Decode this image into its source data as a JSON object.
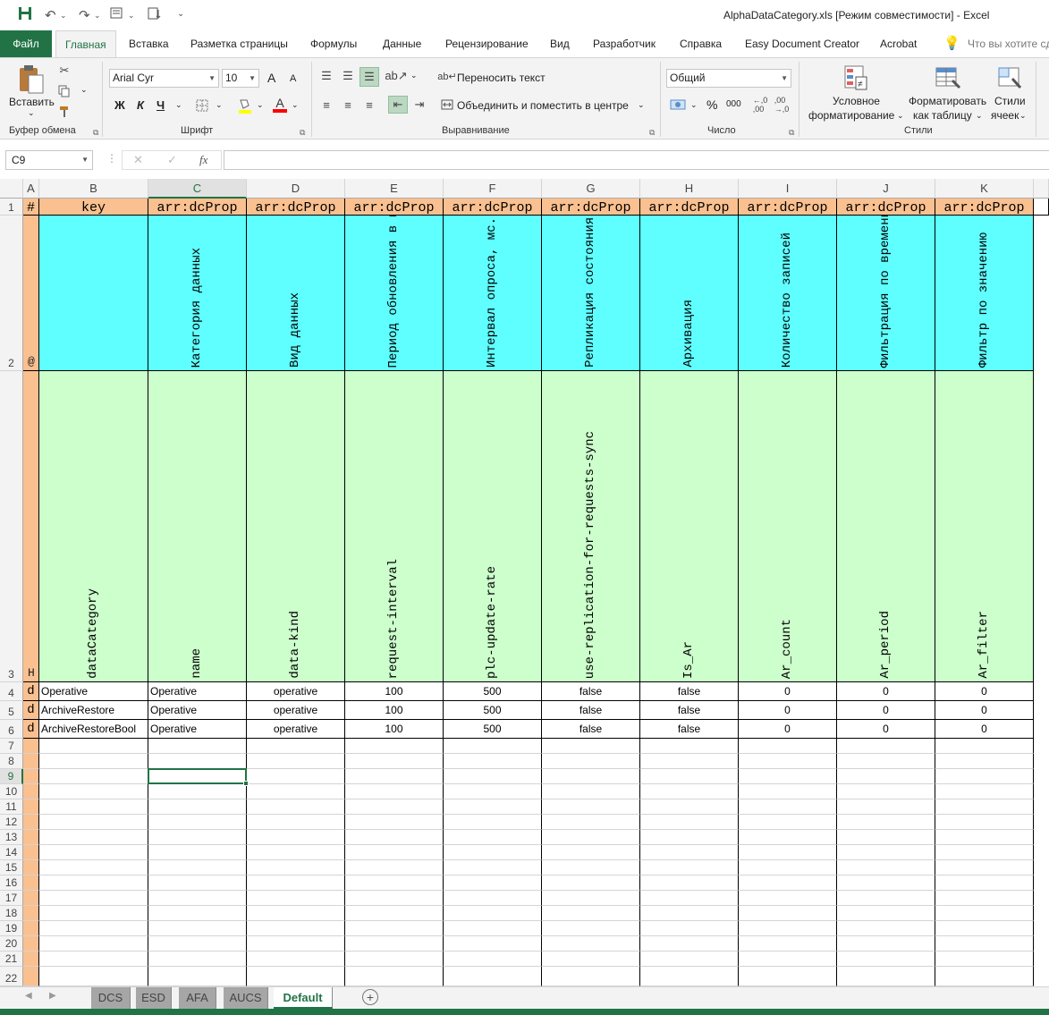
{
  "app": {
    "document_title": "AlphaDataCategory.xls  [Режим совместимости]  -  Excel"
  },
  "quick_access": {
    "save_icon": "save-icon",
    "undo_icon": "undo-icon",
    "redo_icon": "redo-icon",
    "customize_icon": "chevron-down-icon"
  },
  "menu": {
    "file": "Файл",
    "tabs": [
      "Главная",
      "Вставка",
      "Разметка страницы",
      "Формулы",
      "Данные",
      "Рецензирование",
      "Вид",
      "Разработчик",
      "Справка",
      "Easy Document Creator",
      "Acrobat"
    ],
    "active_tab": "Главная",
    "search_placeholder": "Что вы хотите сд"
  },
  "ribbon": {
    "clipboard": {
      "paste_label": "Вставить",
      "group_label": "Буфер обмена"
    },
    "font": {
      "font_name": "Arial Cyr",
      "font_size": "10",
      "bold": "Ж",
      "italic": "К",
      "underline": "Ч",
      "grow": "A",
      "shrink": "A",
      "font_color_letter": "A",
      "highlight_color": "#ffff00",
      "font_color": "#ff0000",
      "group_label": "Шрифт"
    },
    "alignment": {
      "wrap_text": "Переносить текст",
      "merge_center": "Объединить и поместить в центре",
      "group_label": "Выравнивание"
    },
    "number": {
      "format": "Общий",
      "percent": "%",
      "thousands": "000",
      "group_label": "Число"
    },
    "styles": {
      "conditional_line1": "Условное",
      "conditional_line2": "форматирование",
      "table_line1": "Форматировать",
      "table_line2": "как таблицу",
      "cell_styles_line1": "Стили",
      "cell_styles_line2": "ячеек",
      "group_label": "Стили"
    }
  },
  "formula_bar": {
    "name_box": "C9",
    "fx": "fx",
    "cancel": "✕",
    "enter": "✓",
    "value": ""
  },
  "grid": {
    "columns": [
      "A",
      "B",
      "C",
      "D",
      "E",
      "F",
      "G",
      "H",
      "I",
      "J",
      "K"
    ],
    "selected_column": "C",
    "selected_row": "9",
    "row_numbers": [
      "1",
      "2",
      "3",
      "4",
      "5",
      "6",
      "7",
      "8",
      "9",
      "10",
      "11",
      "12",
      "13",
      "14",
      "15",
      "16",
      "17",
      "18",
      "19",
      "20",
      "21",
      "22"
    ],
    "row1": [
      "#",
      "key",
      "arr:dcProp",
      "arr:dcProp",
      "arr:dcProp",
      "arr:dcProp",
      "arr:dcProp",
      "arr:dcProp",
      "arr:dcProp",
      "arr:dcProp",
      "arr:dcProp"
    ],
    "row2": [
      "@",
      "",
      "Категория данных",
      "Вид данных",
      "Период обновления в контроллере, мс.",
      "Интервал опроса, мс.",
      "Репликация состояния чтения",
      "Архивация",
      "Количество записей",
      "Фильтрация по времени",
      "Фильтр по значению"
    ],
    "row3": [
      "H",
      "dataCategory",
      "name",
      "data-kind",
      "request-interval",
      "plc-update-rate",
      "use-replication-for-requests-sync",
      "Is_Ar",
      "Ar_count",
      "Ar_period",
      "Ar_filter"
    ],
    "data_rows": [
      [
        "d",
        "Operative",
        "Operative",
        "operative",
        "100",
        "500",
        "false",
        "false",
        "0",
        "0",
        "0"
      ],
      [
        "d",
        "ArchiveRestore",
        "Operative",
        "operative",
        "100",
        "500",
        "false",
        "false",
        "0",
        "0",
        "0"
      ],
      [
        "d",
        "ArchiveRestoreBool",
        "Operative",
        "operative",
        "100",
        "500",
        "false",
        "false",
        "0",
        "0",
        "0"
      ]
    ],
    "colors": {
      "header_orange": "#fac090",
      "header_cyan": "#5fffff",
      "header_green": "#ccffcc",
      "accent": "#217346"
    }
  },
  "sheets": {
    "tabs": [
      "DCS",
      "ESD",
      "AFA",
      "AUCS",
      "Default"
    ],
    "active": "Default",
    "add_icon": "plus-circle-icon"
  }
}
